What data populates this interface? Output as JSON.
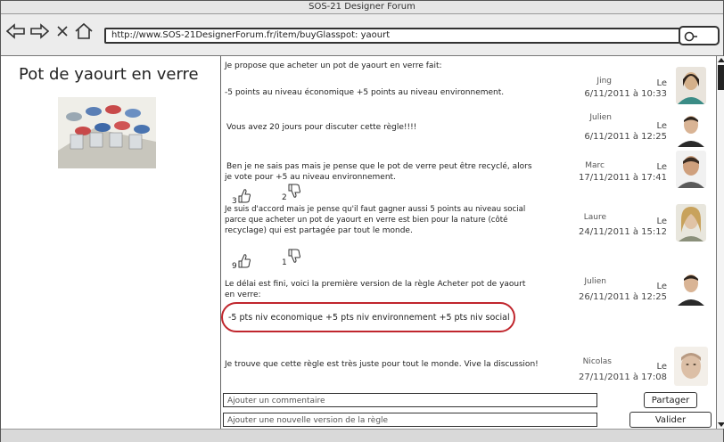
{
  "window": {
    "title": "SOS-21 Designer Forum"
  },
  "browser": {
    "url": "http://www.SOS-21DesignerForum.fr/item/buyGlasspot: yaourt",
    "back_icon": "back-arrow-icon",
    "forward_icon": "forward-arrow-icon",
    "close_icon": "close-icon",
    "home_icon": "home-icon",
    "search_icon": "search-icon"
  },
  "item": {
    "title": "Pot de yaourt en verre"
  },
  "messages": [
    {
      "lines": [
        "Je propose que acheter un pot de yaourt en verre fait:",
        "-5 points au niveau économique    +5 points au niveau environnement."
      ],
      "author": "Jing",
      "date_prefix": "Le",
      "date": "6/11/2011 à 10:33"
    },
    {
      "lines": [
        "Vous avez 20 jours pour discuter cette règle!!!!"
      ],
      "author": "Julien",
      "date_prefix": "Le",
      "date": "6/11/2011 à 12:25"
    },
    {
      "lines": [
        "Ben je ne sais pas mais je pense que le pot de verre peut être recyclé, alors",
        "je vote pour +5 au niveau environnement."
      ],
      "author": "Marc",
      "date_prefix": "Le",
      "date": "17/11/2011 à 17:41",
      "votes_up": "3",
      "votes_down": "2"
    },
    {
      "lines": [
        "Je suis d'accord mais je pense qu'il faut gagner aussi 5 points au niveau social",
        "parce que  acheter un pot de yaourt en verre  est bien pour la nature (côté",
        "recyclage) qui est partagée par tout le monde."
      ],
      "author": "Laure",
      "date_prefix": "Le",
      "date": "24/11/2011 à 15:12",
      "votes_up": "9",
      "votes_down": "1"
    },
    {
      "lines": [
        "Le délai est fini, voici la première version de la règle Acheter pot de yaourt",
        "en verre:"
      ],
      "rule": "-5 pts niv economique  +5 pts niv environnement  +5 pts niv social",
      "author": "Julien",
      "date_prefix": "Le",
      "date": "26/11/2011 à 12:25"
    },
    {
      "lines": [
        "Je trouve que cette règle est très juste pour tout le monde. Vive la discussion!"
      ],
      "author": "Nicolas",
      "date_prefix": "Le",
      "date": "27/11/2011 à 17:08"
    }
  ],
  "comment_input": {
    "placeholder": "Ajouter un commentaire"
  },
  "rule_input": {
    "placeholder": "Ajouter une nouvelle version de la règle"
  },
  "buttons": {
    "share": "Partager",
    "validate": "Valider"
  },
  "colors": {
    "highlight": "#c0262d"
  }
}
